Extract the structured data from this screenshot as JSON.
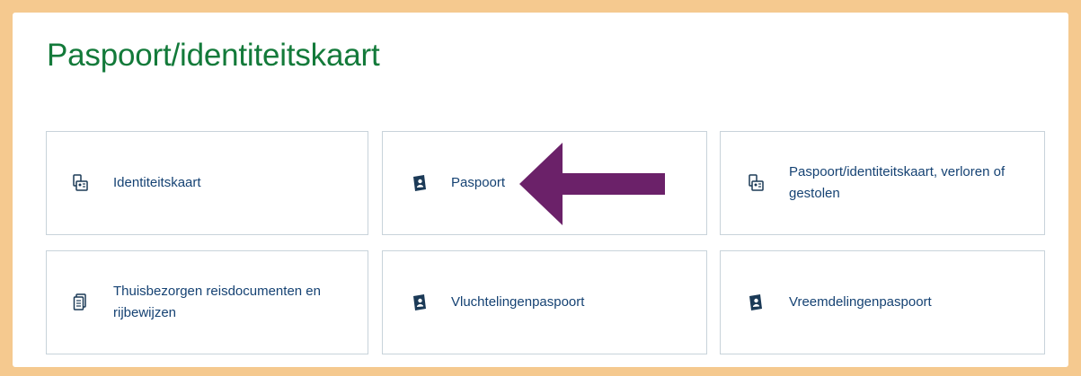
{
  "page": {
    "title": "Paspoort/identiteitskaart"
  },
  "tiles": [
    {
      "label": "Identiteitskaart",
      "icon": "id-card-icon"
    },
    {
      "label": "Paspoort",
      "icon": "passport-icon"
    },
    {
      "label": "Paspoort/identiteitskaart, verloren of gestolen",
      "icon": "id-card-icon"
    },
    {
      "label": "Thuisbezorgen reisdocumenten en rijbewijzen",
      "icon": "documents-icon"
    },
    {
      "label": "Vluchtelingenpaspoort",
      "icon": "passport-icon"
    },
    {
      "label": "Vreemdelingenpaspoort",
      "icon": "passport-icon"
    }
  ],
  "colors": {
    "frame": "#f5c98f",
    "title": "#137a3a",
    "link": "#154273",
    "border": "#c8d3da",
    "arrow": "#6b2169"
  }
}
